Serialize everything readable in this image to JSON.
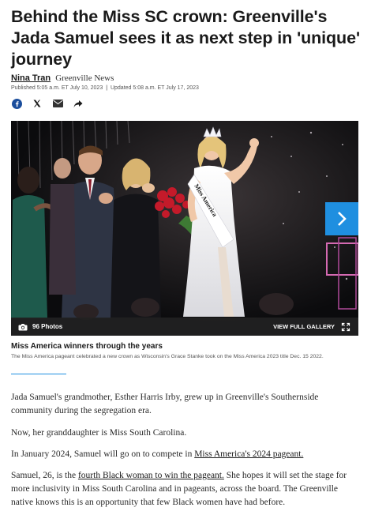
{
  "article": {
    "headline": "Behind the Miss SC crown: Greenville's Jada Samuel sees it as next step in 'unique' journey",
    "author": "Nina Tran",
    "outlet": "Greenville News",
    "published": "Published 5:05 a.m. ET July 10, 2023",
    "separator": "|",
    "updated": "Updated 5:08 a.m. ET July 17, 2023"
  },
  "share": {
    "icons": [
      "facebook-icon",
      "x-icon",
      "email-icon",
      "share-arrow-icon"
    ]
  },
  "gallery": {
    "photo_count": "96 Photos",
    "view_label": "VIEW FULL GALLERY",
    "caption_title": "Miss America winners through the years",
    "caption_text": "The Miss America pageant celebrated a new crown as Wisconsin's Grace Stanke took on the Miss America 2023 title Dec. 15 2022.",
    "sash_text": "Miss America",
    "colors": {
      "accent": "#1f8fe0",
      "bar": "#222222"
    }
  },
  "body": {
    "p1": "Jada Samuel's grandmother, Esther Harris Irby, grew up in Greenville's Southernside community during the segregation era.",
    "p2": "Now, her granddaughter is Miss South Carolina.",
    "p3_before": "In January 2024, Samuel will go on to compete in ",
    "p3_link": "Miss America's 2024 pageant.",
    "p4_before": "Samuel, 26, is the ",
    "p4_link": "fourth Black woman to win the pageant.",
    "p4_after": " She hopes it will set the stage for more inclusivity in Miss South Carolina and in pageants, across the board. The Greenville native knows this is an opportunity that few Black women have had before."
  }
}
